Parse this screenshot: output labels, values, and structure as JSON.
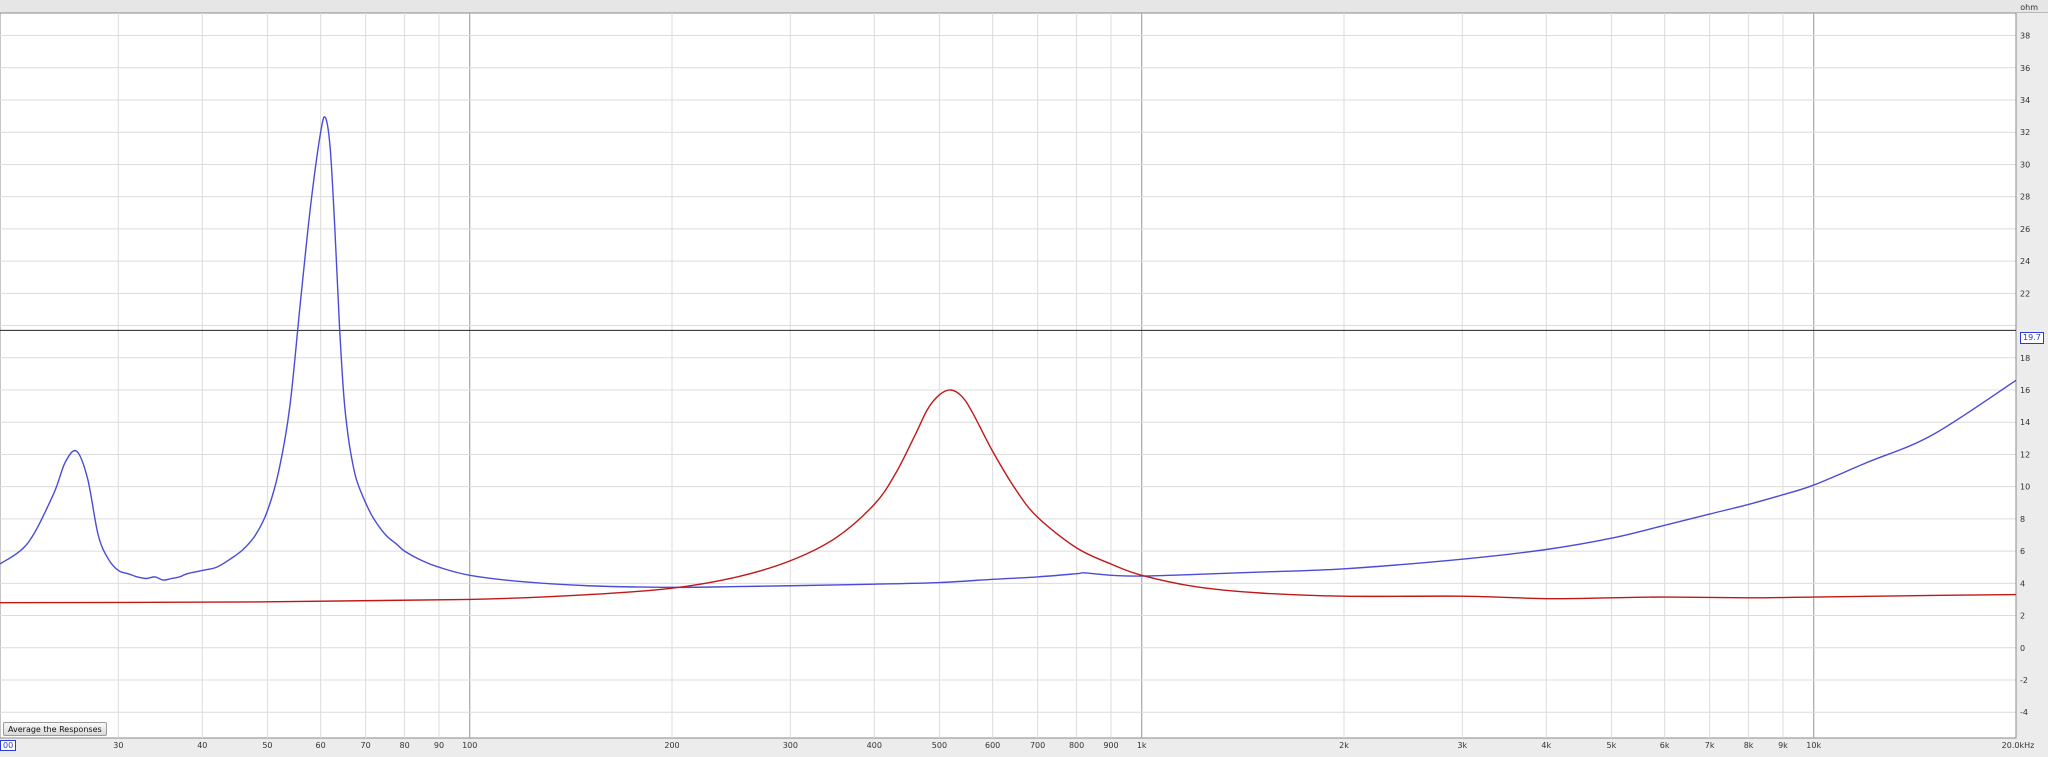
{
  "toolbar": {
    "average_button_label": "Average the Responses"
  },
  "cursor": {
    "x_readout": "00",
    "y_readout": "19.7"
  },
  "colors": {
    "series_blue": "#4a4cd8",
    "series_red": "#c01818",
    "plot_background": "#ffffff",
    "grid_minor": "#dcdcdc",
    "grid_major": "#a8a8a8",
    "cursor_line": "#222222",
    "axis_text": "#333333"
  },
  "chart_data": {
    "type": "line",
    "title": "",
    "xlabel": "",
    "ylabel": "ohm",
    "x_scale": "log",
    "x_unit": "Hz",
    "xlim": [
      20,
      20000
    ],
    "ylim": [
      -5.6,
      39.4
    ],
    "grid": true,
    "legend": "none",
    "x_ticks": [
      {
        "value": 30,
        "label": "30"
      },
      {
        "value": 40,
        "label": "40"
      },
      {
        "value": 50,
        "label": "50"
      },
      {
        "value": 60,
        "label": "60"
      },
      {
        "value": 70,
        "label": "70"
      },
      {
        "value": 80,
        "label": "80"
      },
      {
        "value": 90,
        "label": "90"
      },
      {
        "value": 100,
        "label": "100"
      },
      {
        "value": 200,
        "label": "200"
      },
      {
        "value": 300,
        "label": "300"
      },
      {
        "value": 400,
        "label": "400"
      },
      {
        "value": 500,
        "label": "500"
      },
      {
        "value": 600,
        "label": "600"
      },
      {
        "value": 700,
        "label": "700"
      },
      {
        "value": 800,
        "label": "800"
      },
      {
        "value": 900,
        "label": "900"
      },
      {
        "value": 1000,
        "label": "1k"
      },
      {
        "value": 2000,
        "label": "2k"
      },
      {
        "value": 3000,
        "label": "3k"
      },
      {
        "value": 4000,
        "label": "4k"
      },
      {
        "value": 5000,
        "label": "5k"
      },
      {
        "value": 6000,
        "label": "6k"
      },
      {
        "value": 7000,
        "label": "7k"
      },
      {
        "value": 8000,
        "label": "8k"
      },
      {
        "value": 9000,
        "label": "9k"
      },
      {
        "value": 10000,
        "label": "10k"
      },
      {
        "value": 20000,
        "label": "20.0kHz"
      }
    ],
    "x_major_gridlines": [
      100,
      1000,
      10000
    ],
    "y_ticks": [
      {
        "value": 38,
        "label": "38"
      },
      {
        "value": 36,
        "label": "36"
      },
      {
        "value": 34,
        "label": "34"
      },
      {
        "value": 32,
        "label": "32"
      },
      {
        "value": 30,
        "label": "30"
      },
      {
        "value": 28,
        "label": "28"
      },
      {
        "value": 26,
        "label": "26"
      },
      {
        "value": 24,
        "label": "24"
      },
      {
        "value": 22,
        "label": "22"
      },
      {
        "value": 18,
        "label": "18"
      },
      {
        "value": 16,
        "label": "16"
      },
      {
        "value": 14,
        "label": "14"
      },
      {
        "value": 12,
        "label": "12"
      },
      {
        "value": 10,
        "label": "10"
      },
      {
        "value": 8,
        "label": "8"
      },
      {
        "value": 6,
        "label": "6"
      },
      {
        "value": 4,
        "label": "4"
      },
      {
        "value": 2,
        "label": "2"
      },
      {
        "value": 0,
        "label": "0"
      },
      {
        "value": -2,
        "label": "-2"
      },
      {
        "value": -4,
        "label": "-4"
      }
    ],
    "cursor_y": 19.7,
    "series": [
      {
        "color": "#4a4cd8",
        "x": [
          20,
          22,
          24,
          25,
          26,
          27,
          28,
          29,
          30,
          31,
          32,
          33,
          34,
          35,
          36,
          37,
          38,
          40,
          42,
          44,
          46,
          48,
          50,
          52,
          54,
          56,
          58,
          60,
          61,
          62,
          63,
          64,
          65,
          66,
          67,
          68,
          70,
          72,
          75,
          78,
          80,
          85,
          90,
          100,
          120,
          150,
          200,
          250,
          300,
          400,
          500,
          600,
          700,
          800,
          820,
          900,
          1000,
          1200,
          1500,
          2000,
          3000,
          4000,
          5000,
          6000,
          7000,
          8000,
          9000,
          10000,
          12000,
          15000,
          20000
        ],
        "y": [
          5.2,
          6.5,
          9.5,
          11.5,
          12.2,
          10.5,
          7.0,
          5.5,
          4.8,
          4.6,
          4.4,
          4.3,
          4.4,
          4.2,
          4.3,
          4.4,
          4.6,
          4.8,
          5.0,
          5.5,
          6.1,
          7.0,
          8.5,
          11.0,
          15.0,
          21.5,
          27.5,
          32.0,
          32.9,
          31.0,
          26.0,
          20.0,
          15.5,
          13.0,
          11.4,
          10.3,
          9.0,
          8.0,
          7.0,
          6.4,
          6.0,
          5.4,
          5.0,
          4.5,
          4.1,
          3.85,
          3.75,
          3.8,
          3.85,
          3.95,
          4.05,
          4.25,
          4.4,
          4.6,
          4.65,
          4.5,
          4.45,
          4.55,
          4.7,
          4.9,
          5.5,
          6.1,
          6.8,
          7.6,
          8.3,
          8.9,
          9.5,
          10.1,
          11.5,
          13.2,
          16.6
        ]
      },
      {
        "color": "#c01818",
        "x": [
          20,
          50,
          100,
          150,
          200,
          250,
          300,
          350,
          400,
          430,
          460,
          480,
          500,
          520,
          540,
          560,
          600,
          650,
          700,
          800,
          900,
          1000,
          1200,
          1500,
          2000,
          3000,
          4000,
          5000,
          6000,
          8000,
          10000,
          15000,
          20000
        ],
        "y": [
          2.8,
          2.85,
          3.0,
          3.3,
          3.7,
          4.4,
          5.4,
          6.8,
          8.9,
          10.8,
          13.2,
          14.8,
          15.7,
          16.0,
          15.6,
          14.6,
          12.2,
          9.8,
          8.1,
          6.2,
          5.2,
          4.5,
          3.8,
          3.4,
          3.2,
          3.2,
          3.05,
          3.1,
          3.15,
          3.1,
          3.15,
          3.25,
          3.3
        ]
      }
    ]
  }
}
